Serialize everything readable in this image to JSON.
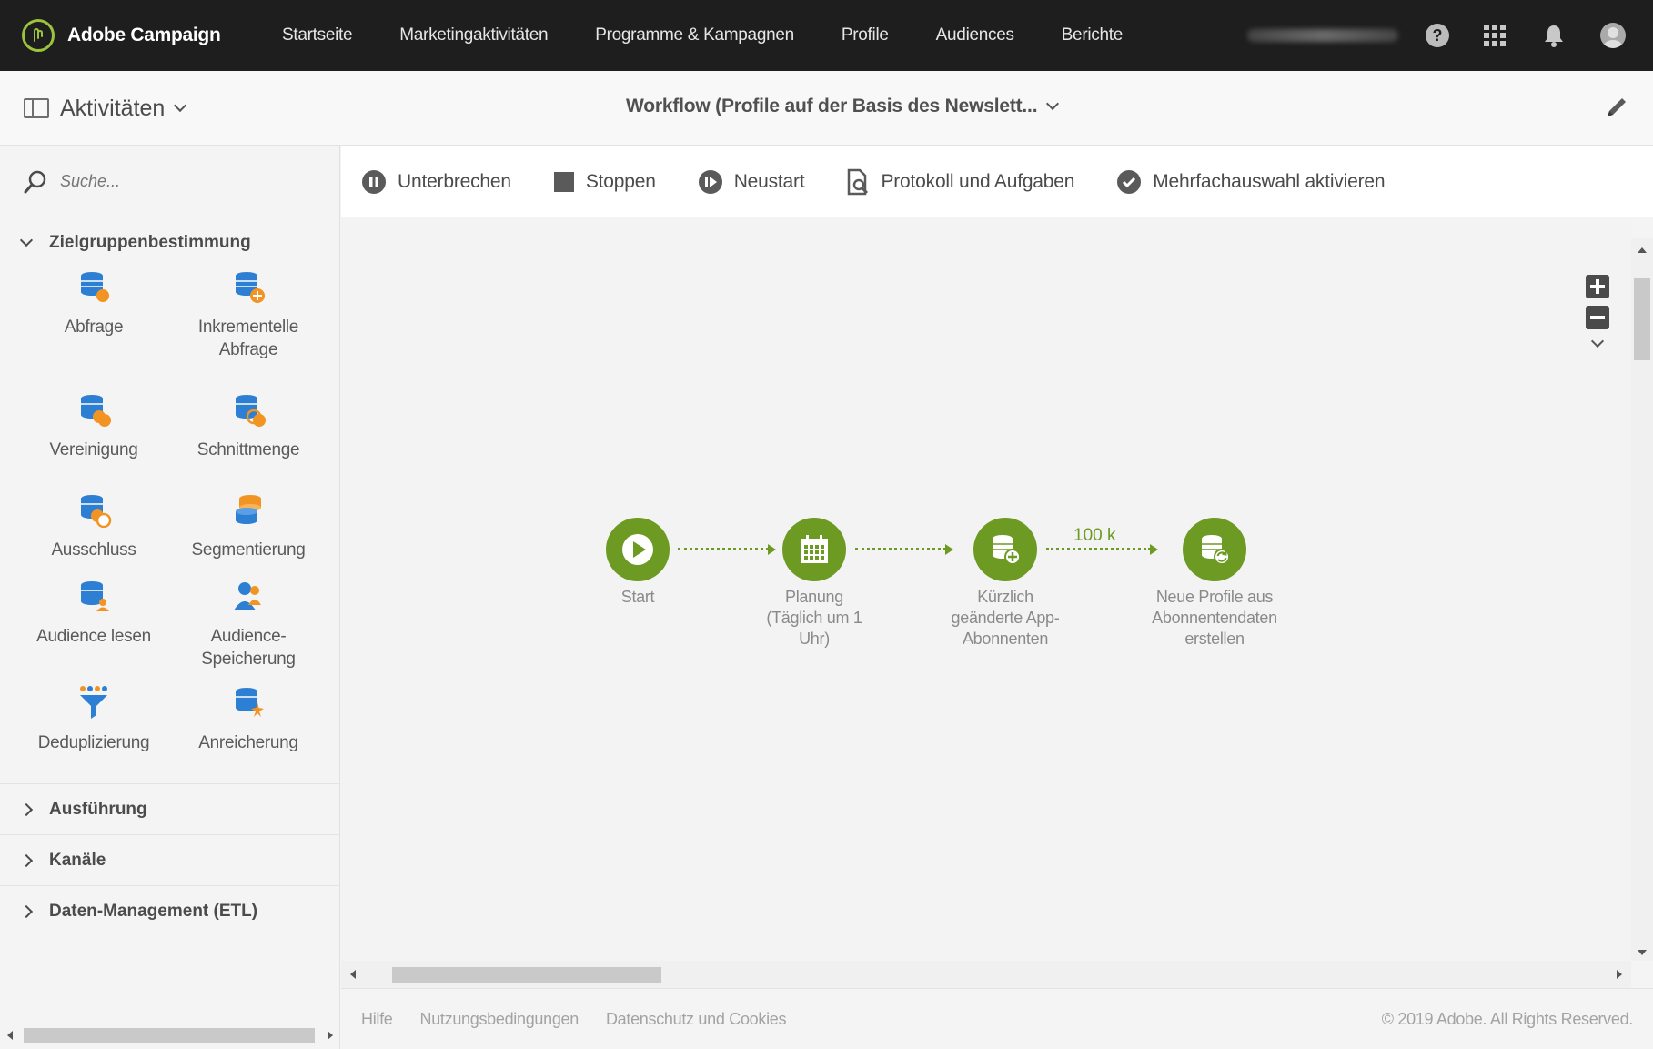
{
  "app": {
    "name": "Adobe Campaign"
  },
  "nav": {
    "items": [
      "Startseite",
      "Marketingaktivitäten",
      "Programme & Kampagnen",
      "Profile",
      "Audiences",
      "Berichte"
    ]
  },
  "user": {
    "help": "?"
  },
  "header": {
    "activities_label": "Aktivitäten",
    "workflow_title": "Workflow (Profile auf der Basis des Newslett..."
  },
  "sidebar": {
    "search_placeholder": "Suche...",
    "sections": [
      {
        "label": "Zielgruppenbestimmung",
        "expanded": true
      },
      {
        "label": "Ausführung",
        "expanded": false
      },
      {
        "label": "Kanäle",
        "expanded": false
      },
      {
        "label": "Daten-Management (ETL)",
        "expanded": false
      }
    ],
    "activities": [
      {
        "label": "Abfrage",
        "icon": "query-icon"
      },
      {
        "label": "Inkrementelle Abfrage",
        "icon": "incremental-query-icon"
      },
      {
        "label": "Vereinigung",
        "icon": "union-icon"
      },
      {
        "label": "Schnittmenge",
        "icon": "intersection-icon"
      },
      {
        "label": "Ausschluss",
        "icon": "exclusion-icon"
      },
      {
        "label": "Segmentierung",
        "icon": "segmentation-icon"
      },
      {
        "label": "Audience lesen",
        "icon": "read-audience-icon"
      },
      {
        "label": "Audience-Speicherung",
        "icon": "save-audience-icon"
      },
      {
        "label": "Deduplizierung",
        "icon": "deduplication-icon"
      },
      {
        "label": "Anreicherung",
        "icon": "enrichment-icon"
      }
    ]
  },
  "toolbar": {
    "pause_label": "Unterbrechen",
    "stop_label": "Stoppen",
    "restart_label": "Neustart",
    "logs_label": "Protokoll und Aufgaben",
    "multiselect_label": "Mehrfachauswahl aktivieren"
  },
  "workflow": {
    "nodes": [
      {
        "label": "Start",
        "icon": "play-icon"
      },
      {
        "label": "Planung (Täglich um 1 Uhr)",
        "icon": "calendar-icon"
      },
      {
        "label": "Kürzlich geänderte App-Abonnenten",
        "icon": "database-add-icon"
      },
      {
        "label": "Neue Profile aus Abonnentendaten erstellen",
        "icon": "database-refresh-icon"
      }
    ],
    "transition_count": "100 k"
  },
  "footer": {
    "help": "Hilfe",
    "terms": "Nutzungsbedingungen",
    "privacy": "Datenschutz und Cookies",
    "copyright": "© 2019 Adobe. All Rights Reserved."
  },
  "colors": {
    "topbar": "#1e1e1e",
    "accent_green": "#6d9a22",
    "icon_blue": "#2d7fd3",
    "icon_orange": "#f29423"
  }
}
